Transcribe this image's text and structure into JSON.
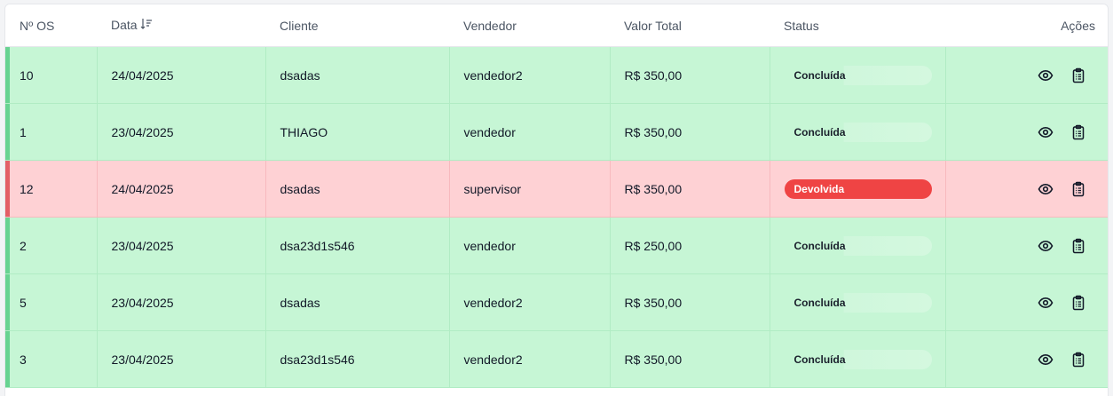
{
  "table": {
    "headers": {
      "os": "Nº OS",
      "date": "Data",
      "client": "Cliente",
      "seller": "Vendedor",
      "total": "Valor Total",
      "status": "Status",
      "actions": "Ações"
    },
    "rows": [
      {
        "os": "10",
        "date": "24/04/2025",
        "client": "dsadas",
        "seller": "vendedor2",
        "total": "R$ 350,00",
        "status": "Concluída",
        "status_kind": "concluida"
      },
      {
        "os": "1",
        "date": "23/04/2025",
        "client": "THIAGO",
        "seller": "vendedor",
        "total": "R$ 350,00",
        "status": "Concluída",
        "status_kind": "concluida"
      },
      {
        "os": "12",
        "date": "24/04/2025",
        "client": "dsadas",
        "seller": "supervisor",
        "total": "R$ 350,00",
        "status": "Devolvida",
        "status_kind": "devolvida"
      },
      {
        "os": "2",
        "date": "23/04/2025",
        "client": "dsa23d1s546",
        "seller": "vendedor",
        "total": "R$ 250,00",
        "status": "Concluída",
        "status_kind": "concluida"
      },
      {
        "os": "5",
        "date": "23/04/2025",
        "client": "dsadas",
        "seller": "vendedor2",
        "total": "R$ 350,00",
        "status": "Concluída",
        "status_kind": "concluida"
      },
      {
        "os": "3",
        "date": "23/04/2025",
        "client": "dsa23d1s546",
        "seller": "vendedor2",
        "total": "R$ 350,00",
        "status": "Concluída",
        "status_kind": "concluida"
      }
    ]
  },
  "icons": {
    "sort": "sort-descending-icon",
    "view": "eye-icon",
    "report": "clipboard-list-icon"
  },
  "colors": {
    "concluida_row": "#c6f6d5",
    "devolvida_row": "#fed1d4",
    "concluida_accent": "#68d391",
    "devolvida_accent": "#e35f67",
    "devolvida_badge": "#ef4444"
  }
}
